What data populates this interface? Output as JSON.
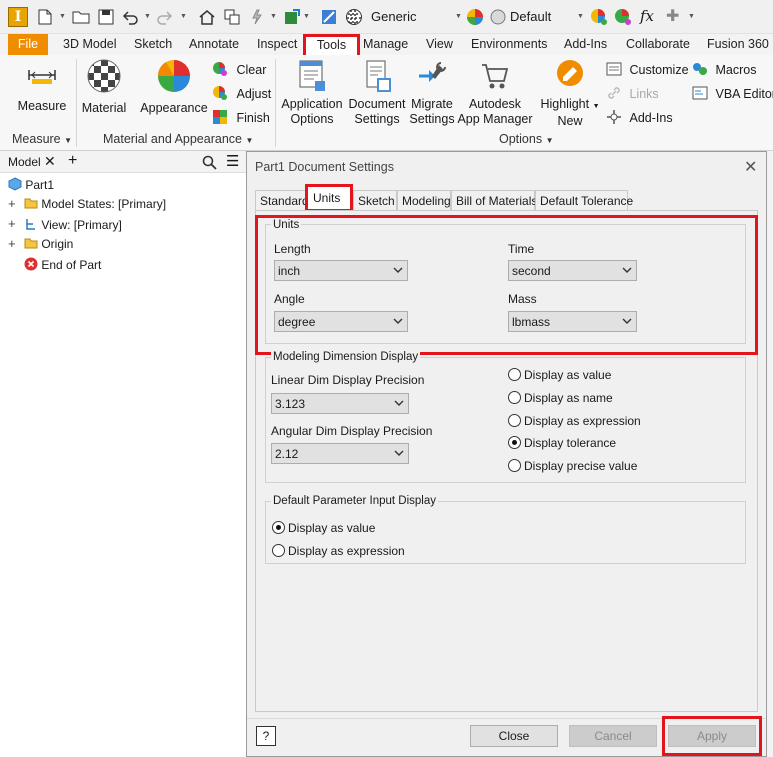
{
  "quick_access": {
    "document_type": "Generic",
    "appearance": "Default",
    "fx_label": "fx"
  },
  "ribbon_tabs": [
    "File",
    "3D Model",
    "Sketch",
    "Annotate",
    "Inspect",
    "Tools",
    "Manage",
    "View",
    "Environments",
    "Add-Ins",
    "Collaborate",
    "Fusion 360"
  ],
  "ribbon": {
    "measure": "Measure",
    "material": "Material",
    "appearance": "Appearance",
    "clear": "Clear",
    "adjust": "Adjust",
    "finish": "Finish",
    "application_options": [
      "Application",
      "Options"
    ],
    "document_settings": [
      "Document",
      "Settings"
    ],
    "migrate_settings": [
      "Migrate",
      "Settings"
    ],
    "autodesk_app_manager": [
      "Autodesk",
      "App Manager"
    ],
    "highlight_new": [
      "Highlight",
      "New"
    ],
    "customize": "Customize",
    "links": "Links",
    "add_ins": "Add-Ins",
    "macros": "Macros",
    "vba_editor": "VBA Editor",
    "groups": {
      "measure": "Measure",
      "material_appearance": "Material and Appearance",
      "options": "Options"
    }
  },
  "browser": {
    "tab_label": "Model",
    "tree": [
      "Part1",
      "Model States: [Primary]",
      "View: [Primary]",
      "Origin",
      "End of Part"
    ]
  },
  "dialog": {
    "title": "Part1 Document Settings",
    "tabs": [
      "Standard",
      "Units",
      "Sketch",
      "Modeling",
      "Bill of Materials",
      "Default Tolerance"
    ],
    "units_group": {
      "label": "Units",
      "length_label": "Length",
      "length_value": "inch",
      "time_label": "Time",
      "time_value": "second",
      "angle_label": "Angle",
      "angle_value": "degree",
      "mass_label": "Mass",
      "mass_value": "lbmass"
    },
    "modeling_group": {
      "label": "Modeling Dimension Display",
      "linear_label": "Linear Dim Display Precision",
      "linear_value": "3.123",
      "angular_label": "Angular Dim Display Precision",
      "angular_value": "2.12",
      "options": [
        "Display as value",
        "Display as name",
        "Display as expression",
        "Display tolerance",
        "Display precise value"
      ],
      "selected": "Display tolerance"
    },
    "param_group": {
      "label": "Default Parameter Input Display",
      "options": [
        "Display as value",
        "Display as expression"
      ],
      "selected": "Display as value"
    },
    "buttons": {
      "help": "?",
      "close": "Close",
      "cancel": "Cancel",
      "apply": "Apply"
    }
  },
  "colors": {
    "file_tab": "#f08c00",
    "highlight": "#e3141b"
  }
}
